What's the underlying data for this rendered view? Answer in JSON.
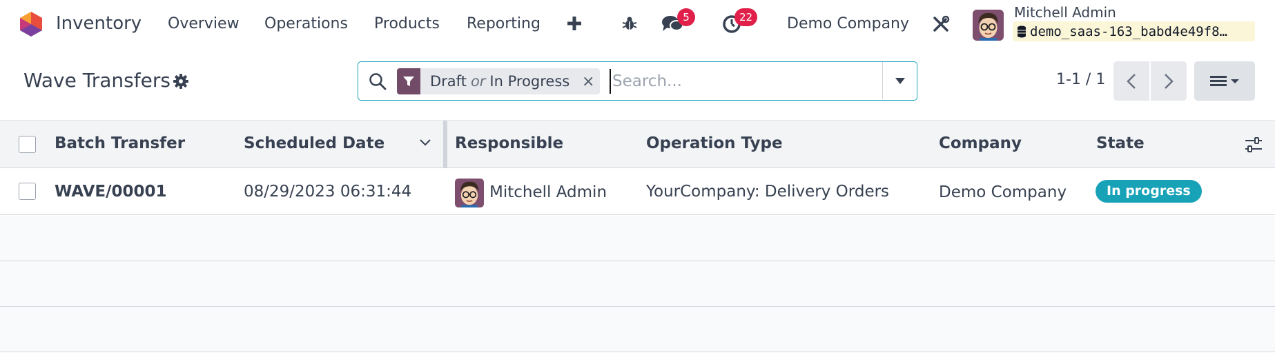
{
  "navbar": {
    "app_name": "Inventory",
    "menu": [
      {
        "label": "Overview"
      },
      {
        "label": "Operations"
      },
      {
        "label": "Products"
      },
      {
        "label": "Reporting"
      }
    ],
    "messages_badge": "5",
    "activities_badge": "22",
    "company": "Demo Company",
    "user_name": "Mitchell Admin",
    "database": "demo_saas-163_babd4e49f8…",
    "brand_color": "#714b67",
    "badge_color": "#e0204a"
  },
  "control_panel": {
    "title": "Wave Transfers",
    "filter_facet": {
      "value_1": "Draft",
      "separator": "or",
      "value_2": "In Progress",
      "close": "×"
    },
    "search_placeholder": "Search...",
    "pager": "1-1 / 1"
  },
  "table": {
    "columns": [
      "Batch Transfer",
      "Scheduled Date",
      "Responsible",
      "Operation Type",
      "Company",
      "State"
    ],
    "rows": [
      {
        "batch_transfer": "WAVE/00001",
        "scheduled_date": "08/29/2023 06:31:44",
        "responsible": "Mitchell Admin",
        "operation_type": "YourCompany: Delivery Orders",
        "company": "Demo Company",
        "state": "In progress"
      }
    ],
    "state_color": "#17a2b8"
  }
}
